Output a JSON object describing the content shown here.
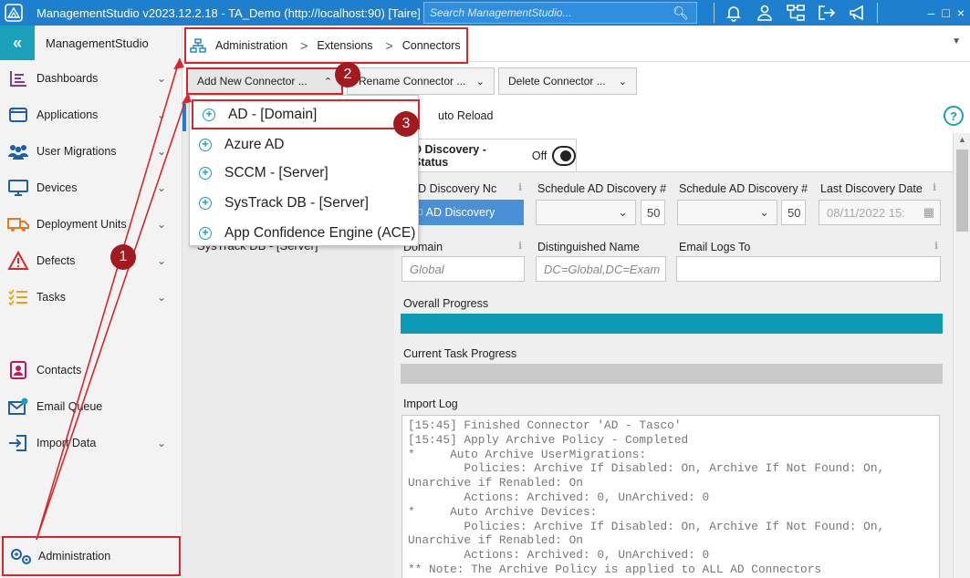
{
  "titlebar": {
    "title": "ManagementStudio v2023.12.2.18 - TA_Demo (http://localhost:90) [Taire]",
    "search_placeholder": "Search ManagementStudio...",
    "window_controls": [
      "–",
      "□",
      "×"
    ]
  },
  "sidebar": {
    "brand": "ManagementStudio",
    "items": [
      {
        "label": "Dashboards",
        "icon": "dashboard-icon"
      },
      {
        "label": "Applications",
        "icon": "application-icon"
      },
      {
        "label": "User Migrations",
        "icon": "users-icon"
      },
      {
        "label": "Devices",
        "icon": "monitor-icon"
      },
      {
        "label": "Deployment Units",
        "icon": "truck-icon"
      },
      {
        "label": "Defects",
        "icon": "warning-icon"
      },
      {
        "label": "Tasks",
        "icon": "tasks-icon"
      },
      {
        "label": "Contacts",
        "icon": "contact-icon"
      },
      {
        "label": "Email Queue",
        "icon": "email-icon"
      },
      {
        "label": "Import Data",
        "icon": "import-icon"
      },
      {
        "label": "Administration",
        "icon": "gears-icon"
      }
    ]
  },
  "breadcrumb": {
    "items": [
      "Administration",
      "Extensions",
      "Connectors"
    ]
  },
  "toolbar": {
    "add_label": "Add New Connector ...",
    "rename_label": "Rename Connector ...",
    "delete_label": "Delete Connector ..."
  },
  "dropdown": {
    "items": [
      "AD - [Domain]",
      "Azure AD",
      "SCCM - [Server]",
      "SysTrack DB - [Server]",
      "App Confidence Engine (ACE)"
    ]
  },
  "list": {
    "items": [
      "SysTrack DB - [Server]"
    ]
  },
  "auto_reload": "uto Reload",
  "tab": {
    "label": "D Discovery - Status",
    "toggle_text": "Off"
  },
  "form": {
    "run_label": "n AD Discovery Nc",
    "run_button": "AD Discovery",
    "schedule1_label": "Schedule AD Discovery #",
    "schedule1_value": "50",
    "schedule2_label": "Schedule AD Discovery #",
    "schedule2_value": "50",
    "last_label": "Last Discovery Date",
    "last_value": "08/11/2022 15:",
    "domain_label": "Domain",
    "domain_value": "Global",
    "dn_label": "Distinguished Name",
    "dn_value": "DC=Global,DC=Exam",
    "email_label": "Email Logs To",
    "email_value": "",
    "overall_label": "Overall Progress",
    "overall_progress": 1.0,
    "task_label": "Current Task Progress",
    "task_progress": 0.0,
    "import_label": "Import Log"
  },
  "log": [
    "[15:45] Finished Connector 'AD - Tasco'",
    "[15:45] Apply Archive Policy - Completed",
    "*     Auto Archive UserMigrations:",
    "        Policies: Archive If Disabled: On, Archive If Not Found: On,",
    "Unarchive if Renabled: On",
    "        Actions: Archived: 0, UnArchived: 0",
    "*     Auto Archive Devices:",
    "        Policies: Archive If Disabled: On, Archive If Not Found: On,",
    "Unarchive if Renabled: On",
    "        Actions: Archived: 0, UnArchived: 0",
    "** Note: The Archive Policy is applied to ALL AD Connectors"
  ],
  "annotations": [
    "1",
    "2",
    "3"
  ],
  "colors": {
    "titlebar": "#1f7fcf",
    "accent": "#1aa0b8",
    "highlight": "#d9262c",
    "badge": "#a11a1f",
    "progress": "#0e9ab5"
  }
}
